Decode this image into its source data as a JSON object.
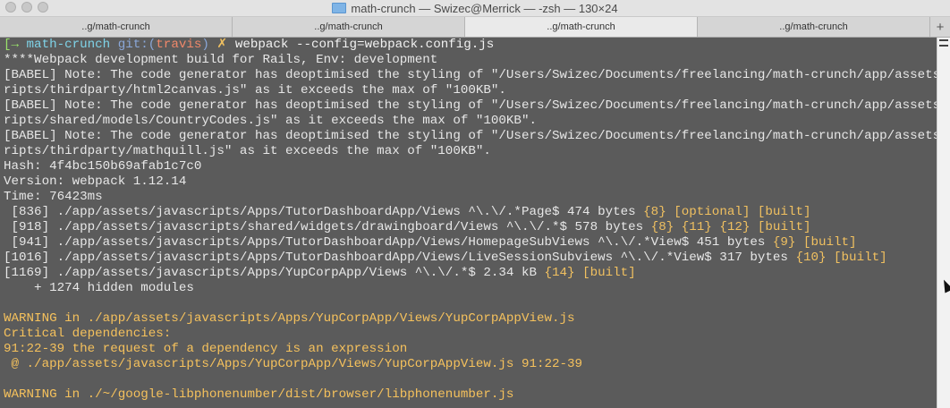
{
  "window": {
    "title": "math-crunch — Swizec@Merrick — -zsh — 130×24"
  },
  "tabs": [
    {
      "label": "..g/math-crunch",
      "active": false
    },
    {
      "label": "..g/math-crunch",
      "active": false
    },
    {
      "label": "..g/math-crunch",
      "active": true
    },
    {
      "label": "..g/math-crunch",
      "active": false
    }
  ],
  "tab_add_label": "+",
  "terminal": {
    "lines": [
      [
        {
          "t": "[→ ",
          "c": "green"
        },
        {
          "t": "math-crunch ",
          "c": "cyan"
        },
        {
          "t": "git:(",
          "c": "blue"
        },
        {
          "t": "travis",
          "c": "red"
        },
        {
          "t": ") ",
          "c": "blue"
        },
        {
          "t": "✗ ",
          "c": "yellow"
        },
        {
          "t": "webpack --config=webpack.config.js",
          "c": "white"
        }
      ],
      [
        {
          "t": "****Webpack development build for Rails, Env: development",
          "c": ""
        }
      ],
      [
        {
          "t": "[BABEL] Note: The code generator has deoptimised the styling of \"/Users/Swizec/Documents/freelancing/math-crunch/app/assets/javas",
          "c": ""
        }
      ],
      [
        {
          "t": "ripts/thirdparty/html2canvas.js\" as it exceeds the max of \"100KB\".",
          "c": ""
        }
      ],
      [
        {
          "t": "[BABEL] Note: The code generator has deoptimised the styling of \"/Users/Swizec/Documents/freelancing/math-crunch/app/assets/javas",
          "c": ""
        }
      ],
      [
        {
          "t": "ripts/shared/models/CountryCodes.js\" as it exceeds the max of \"100KB\".",
          "c": ""
        }
      ],
      [
        {
          "t": "[BABEL] Note: The code generator has deoptimised the styling of \"/Users/Swizec/Documents/freelancing/math-crunch/app/assets/javas",
          "c": ""
        }
      ],
      [
        {
          "t": "ripts/thirdparty/mathquill.js\" as it exceeds the max of \"100KB\".",
          "c": ""
        }
      ],
      [
        {
          "t": "Hash: 4f4bc150b69afab1c7c0",
          "c": ""
        }
      ],
      [
        {
          "t": "Version: webpack 1.12.14",
          "c": ""
        }
      ],
      [
        {
          "t": "Time: 76423ms",
          "c": ""
        }
      ],
      [
        {
          "t": " [836] ./app/assets/javascripts/Apps/TutorDashboardApp/Views ^\\.\\/.*Page$ 474 bytes ",
          "c": ""
        },
        {
          "t": "{8}",
          "c": "yellow"
        },
        {
          "t": " ",
          "c": ""
        },
        {
          "t": "[optional]",
          "c": "yellow"
        },
        {
          "t": " ",
          "c": ""
        },
        {
          "t": "[built]",
          "c": "yellow"
        }
      ],
      [
        {
          "t": " [918] ./app/assets/javascripts/shared/widgets/drawingboard/Views ^\\.\\/.*$ 578 bytes ",
          "c": ""
        },
        {
          "t": "{8}",
          "c": "yellow"
        },
        {
          "t": " ",
          "c": ""
        },
        {
          "t": "{11}",
          "c": "yellow"
        },
        {
          "t": " ",
          "c": ""
        },
        {
          "t": "{12}",
          "c": "yellow"
        },
        {
          "t": " ",
          "c": ""
        },
        {
          "t": "[built]",
          "c": "yellow"
        }
      ],
      [
        {
          "t": " [941] ./app/assets/javascripts/Apps/TutorDashboardApp/Views/HomepageSubViews ^\\.\\/.*View$ 451 bytes ",
          "c": ""
        },
        {
          "t": "{9}",
          "c": "yellow"
        },
        {
          "t": " ",
          "c": ""
        },
        {
          "t": "[built]",
          "c": "yellow"
        }
      ],
      [
        {
          "t": "[1016] ./app/assets/javascripts/Apps/TutorDashboardApp/Views/LiveSessionSubviews ^\\.\\/.*View$ 317 bytes ",
          "c": ""
        },
        {
          "t": "{10}",
          "c": "yellow"
        },
        {
          "t": " ",
          "c": ""
        },
        {
          "t": "[built]",
          "c": "yellow"
        }
      ],
      [
        {
          "t": "[1169] ./app/assets/javascripts/Apps/YupCorpApp/Views ^\\.\\/.*$ 2.34 kB ",
          "c": ""
        },
        {
          "t": "{14}",
          "c": "yellow"
        },
        {
          "t": " ",
          "c": ""
        },
        {
          "t": "[built]",
          "c": "yellow"
        }
      ],
      [
        {
          "t": "    + 1274 hidden modules",
          "c": ""
        }
      ],
      [
        {
          "t": "",
          "c": ""
        }
      ],
      [
        {
          "t": "WARNING in ./app/assets/javascripts/Apps/YupCorpApp/Views/YupCorpAppView.js",
          "c": "warn"
        }
      ],
      [
        {
          "t": "Critical dependencies:",
          "c": "warn"
        }
      ],
      [
        {
          "t": "91:22-39 the request of a dependency is an expression",
          "c": "warn"
        }
      ],
      [
        {
          "t": " @ ./app/assets/javascripts/Apps/YupCorpApp/Views/YupCorpAppView.js 91:22-39",
          "c": "warn"
        }
      ],
      [
        {
          "t": "",
          "c": ""
        }
      ],
      [
        {
          "t": "WARNING in ./~/google-libphonenumber/dist/browser/libphonenumber.js",
          "c": "warn"
        }
      ]
    ]
  },
  "icons": {
    "window_lights": "window-control-icon",
    "folder": "folder-icon",
    "scroll": "scrollbar-lines-icon",
    "cursor": "mouse-cursor-icon"
  }
}
